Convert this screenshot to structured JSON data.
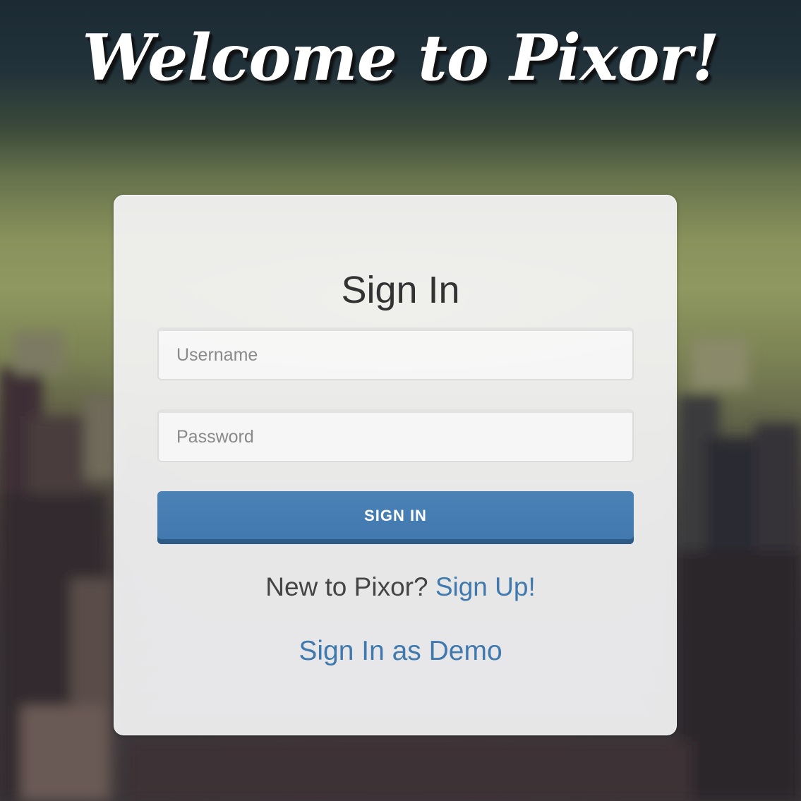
{
  "page": {
    "heading": "Welcome to Pixor!"
  },
  "signin": {
    "title": "Sign In",
    "username_placeholder": "Username",
    "password_placeholder": "Password",
    "submit_label": "SIGN IN",
    "new_prompt": "New to Pixor?",
    "signup_link": "Sign Up!",
    "demo_link": "Sign In as Demo"
  },
  "colors": {
    "accent": "#4178ae",
    "link": "#3f79ad",
    "card_background": "#f5f5f6"
  }
}
